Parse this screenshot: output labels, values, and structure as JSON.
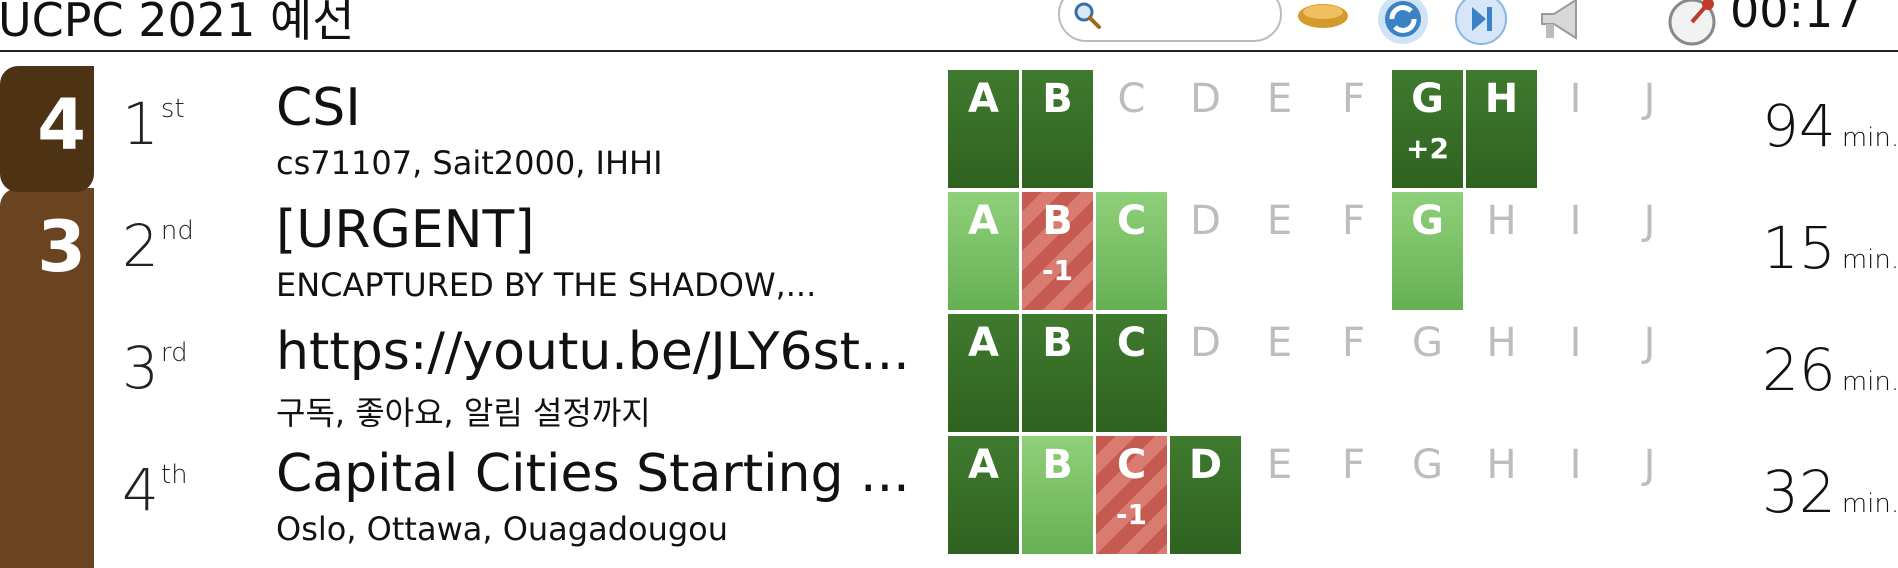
{
  "header": {
    "title": "UCPC 2021 예선",
    "timer": "00:17"
  },
  "solved_groups": [
    {
      "count": "4"
    },
    {
      "count": "3"
    }
  ],
  "rows": [
    {
      "rank": "1",
      "rank_suffix": "st",
      "team": "CSI",
      "members": "cs71107, Sait2000, IHHI",
      "time": "94",
      "time_unit": "min.",
      "problems": [
        {
          "letter": "A",
          "state": "solved",
          "delta": ""
        },
        {
          "letter": "B",
          "state": "solved",
          "delta": ""
        },
        {
          "letter": "C",
          "state": "none",
          "delta": ""
        },
        {
          "letter": "D",
          "state": "none",
          "delta": ""
        },
        {
          "letter": "E",
          "state": "none",
          "delta": ""
        },
        {
          "letter": "F",
          "state": "none",
          "delta": ""
        },
        {
          "letter": "G",
          "state": "solved",
          "delta": "+2"
        },
        {
          "letter": "H",
          "state": "solved",
          "delta": ""
        },
        {
          "letter": "I",
          "state": "none",
          "delta": ""
        },
        {
          "letter": "J",
          "state": "none",
          "delta": ""
        }
      ]
    },
    {
      "rank": "2",
      "rank_suffix": "nd",
      "team": "[URGENT]",
      "members": "ENCAPTURED BY THE SHADOW,...",
      "time": "15",
      "time_unit": "min.",
      "problems": [
        {
          "letter": "A",
          "state": "first",
          "delta": ""
        },
        {
          "letter": "B",
          "state": "pending",
          "delta": "-1"
        },
        {
          "letter": "C",
          "state": "first",
          "delta": ""
        },
        {
          "letter": "D",
          "state": "none",
          "delta": ""
        },
        {
          "letter": "E",
          "state": "none",
          "delta": ""
        },
        {
          "letter": "F",
          "state": "none",
          "delta": ""
        },
        {
          "letter": "G",
          "state": "first",
          "delta": ""
        },
        {
          "letter": "H",
          "state": "none",
          "delta": ""
        },
        {
          "letter": "I",
          "state": "none",
          "delta": ""
        },
        {
          "letter": "J",
          "state": "none",
          "delta": ""
        }
      ]
    },
    {
      "rank": "3",
      "rank_suffix": "rd",
      "team": "https://youtu.be/JLY6st...",
      "members": "구독, 좋아요, 알림 설정까지",
      "time": "26",
      "time_unit": "min.",
      "problems": [
        {
          "letter": "A",
          "state": "solved",
          "delta": ""
        },
        {
          "letter": "B",
          "state": "solved",
          "delta": ""
        },
        {
          "letter": "C",
          "state": "solved",
          "delta": ""
        },
        {
          "letter": "D",
          "state": "none",
          "delta": ""
        },
        {
          "letter": "E",
          "state": "none",
          "delta": ""
        },
        {
          "letter": "F",
          "state": "none",
          "delta": ""
        },
        {
          "letter": "G",
          "state": "none",
          "delta": ""
        },
        {
          "letter": "H",
          "state": "none",
          "delta": ""
        },
        {
          "letter": "I",
          "state": "none",
          "delta": ""
        },
        {
          "letter": "J",
          "state": "none",
          "delta": ""
        }
      ]
    },
    {
      "rank": "4",
      "rank_suffix": "th",
      "team": "Capital Cities Starting ...",
      "members": "Oslo, Ottawa, Ouagadougou",
      "time": "32",
      "time_unit": "min.",
      "problems": [
        {
          "letter": "A",
          "state": "solved",
          "delta": ""
        },
        {
          "letter": "B",
          "state": "first",
          "delta": ""
        },
        {
          "letter": "C",
          "state": "pending",
          "delta": "-1"
        },
        {
          "letter": "D",
          "state": "solved",
          "delta": ""
        },
        {
          "letter": "E",
          "state": "none",
          "delta": ""
        },
        {
          "letter": "F",
          "state": "none",
          "delta": ""
        },
        {
          "letter": "G",
          "state": "none",
          "delta": ""
        },
        {
          "letter": "H",
          "state": "none",
          "delta": ""
        },
        {
          "letter": "I",
          "state": "none",
          "delta": ""
        },
        {
          "letter": "J",
          "state": "none",
          "delta": ""
        }
      ]
    }
  ],
  "icons": [
    "search-icon",
    "freeze-icon",
    "refresh-icon",
    "skip-forward-icon",
    "announce-icon",
    "timer-icon"
  ]
}
